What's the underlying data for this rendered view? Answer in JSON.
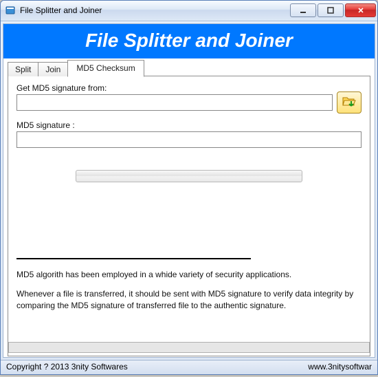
{
  "title": "File Splitter and Joiner",
  "banner": "File Splitter and Joiner",
  "tabs": [
    {
      "label": "Split"
    },
    {
      "label": "Join"
    },
    {
      "label": "MD5 Checksum"
    }
  ],
  "active_tab": 2,
  "md5": {
    "from_label": "Get MD5 signature from:",
    "from_value": "",
    "signature_label": "MD5 signature :",
    "signature_value": ""
  },
  "description": {
    "p1": "MD5 algorith has been employed in a whide variety of security applications.",
    "p2": "Whenever a file is transferred, it should be sent with MD5 signature to verify data integrity by comparing the MD5 signature of transferred file to the authentic signature."
  },
  "status": {
    "left": "Copyright ? 2013 3nity Softwares",
    "right": "www.3nitysoftwar"
  }
}
